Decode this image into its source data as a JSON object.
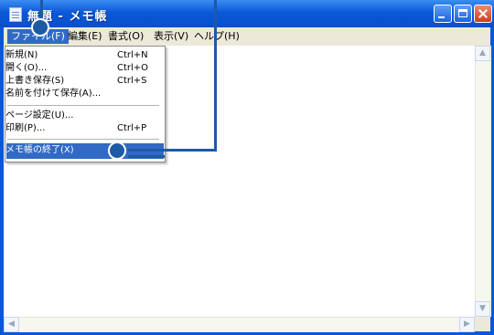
{
  "window": {
    "title": "無題 - メモ帳"
  },
  "menubar": {
    "file": "ファイル(F)",
    "edit": "編集(E)",
    "format": "書式(O)",
    "view": "表示(V)",
    "help": "ヘルプ(H)"
  },
  "file_menu": {
    "items": [
      {
        "label": "新規(N)",
        "shortcut": "Ctrl+N"
      },
      {
        "label": "開く(O)...",
        "shortcut": "Ctrl+O"
      },
      {
        "label": "上書き保存(S)",
        "shortcut": "Ctrl+S"
      },
      {
        "label": "名前を付けて保存(A)...",
        "shortcut": ""
      },
      {
        "label": "ページ設定(U)...",
        "shortcut": ""
      },
      {
        "label": "印刷(P)...",
        "shortcut": "Ctrl+P"
      },
      {
        "label": "メモ帳の終了(X)",
        "shortcut": ""
      }
    ],
    "highlighted_item": "メモ帳の終了(X)"
  },
  "colors": {
    "titlebar": "#0a58d8",
    "menu_highlight": "#316ac5",
    "callout": "#1c5aa6"
  }
}
